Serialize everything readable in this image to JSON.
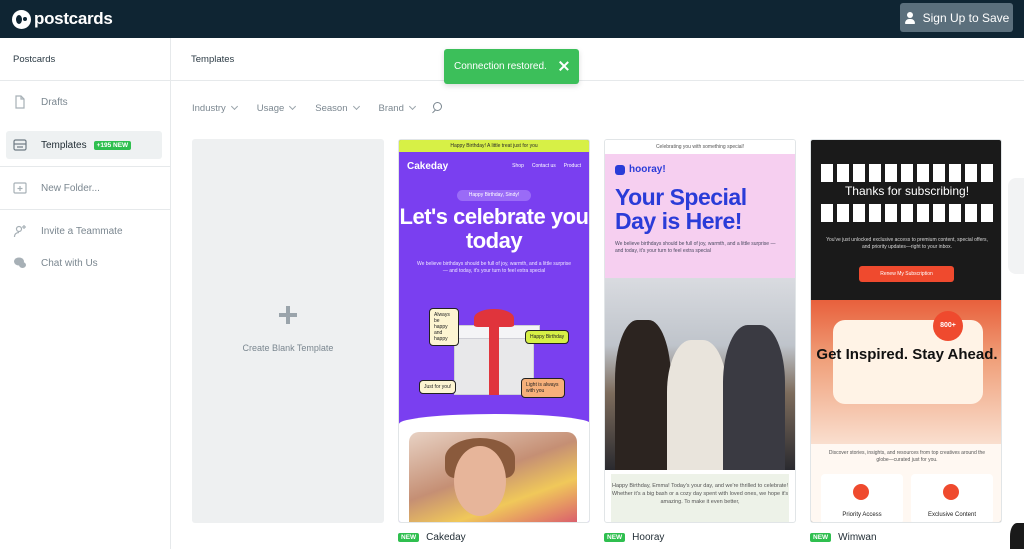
{
  "header": {
    "logo_text": "postcards",
    "signup_label": "Sign Up to Save"
  },
  "sidebar": {
    "title": "Postcards",
    "items": [
      {
        "label": "Drafts",
        "icon": "document-icon"
      },
      {
        "label": "Templates",
        "icon": "templates-icon",
        "badge": "+195 NEW"
      },
      {
        "label": "New Folder...",
        "icon": "folder-plus-icon"
      },
      {
        "label": "Invite a Teammate",
        "icon": "user-plus-icon"
      },
      {
        "label": "Chat with Us",
        "icon": "chat-icon"
      }
    ]
  },
  "main": {
    "title": "Templates",
    "filters": [
      "Industry",
      "Usage",
      "Season",
      "Brand"
    ],
    "blank_template_label": "Create Blank Template"
  },
  "toast": {
    "message": "Connection restored."
  },
  "templates": [
    {
      "name": "Cakeday",
      "badge": "NEW",
      "ribbon": "Happy Birthday! A little treat just for you",
      "brand": "Cakeday",
      "nav": [
        "Shop",
        "Contact us",
        "Product"
      ],
      "pill": "Happy Birthday, Sindy!",
      "headline": "Let's celebrate you today",
      "body": "We believe birthdays should be full of joy, warmth, and a little surprise — and today, it's your turn to feel extra special",
      "stickers": [
        "Always be happy and happy",
        "Happy Birthday",
        "Just for you!",
        "Light is always with you"
      ]
    },
    {
      "name": "Hooray",
      "badge": "NEW",
      "ribbon": "Celebrating you with something special!",
      "brand": "hooray!",
      "headline": "Your Special Day is Here!",
      "body": "We believe birthdays should be full of joy, warmth, and a little surprise — and today, it's your turn to feel extra special",
      "footer": "Happy Birthday, Emma! Today's your day, and we're thrilled to celebrate! Whether it's a big bash or a cozy day spent with loved ones, we hope it's amazing. To make it even better,"
    },
    {
      "name": "Wimwan",
      "badge": "NEW",
      "headline": "Thanks for subscribing!",
      "body": "You've just unlocked exclusive access to premium content, special offers, and priority updates—right to your inbox.",
      "button": "Renew My Subscription",
      "badge_circle": "800+",
      "poster": "Get Inspired. Stay Ahead.",
      "description": "Discover stories, insights, and resources from top creatives around the globe—curated just for you.",
      "tiles": [
        "Priority Access",
        "Exclusive Content"
      ]
    }
  ],
  "colors": {
    "topbar": "#0f2533",
    "toast": "#3cbf5a",
    "badge_green": "#2fbf4f",
    "cakeday_purple": "#7a3ff0",
    "hooray_blue": "#2a3cd8",
    "wimwan_accent": "#ef4a2e"
  }
}
